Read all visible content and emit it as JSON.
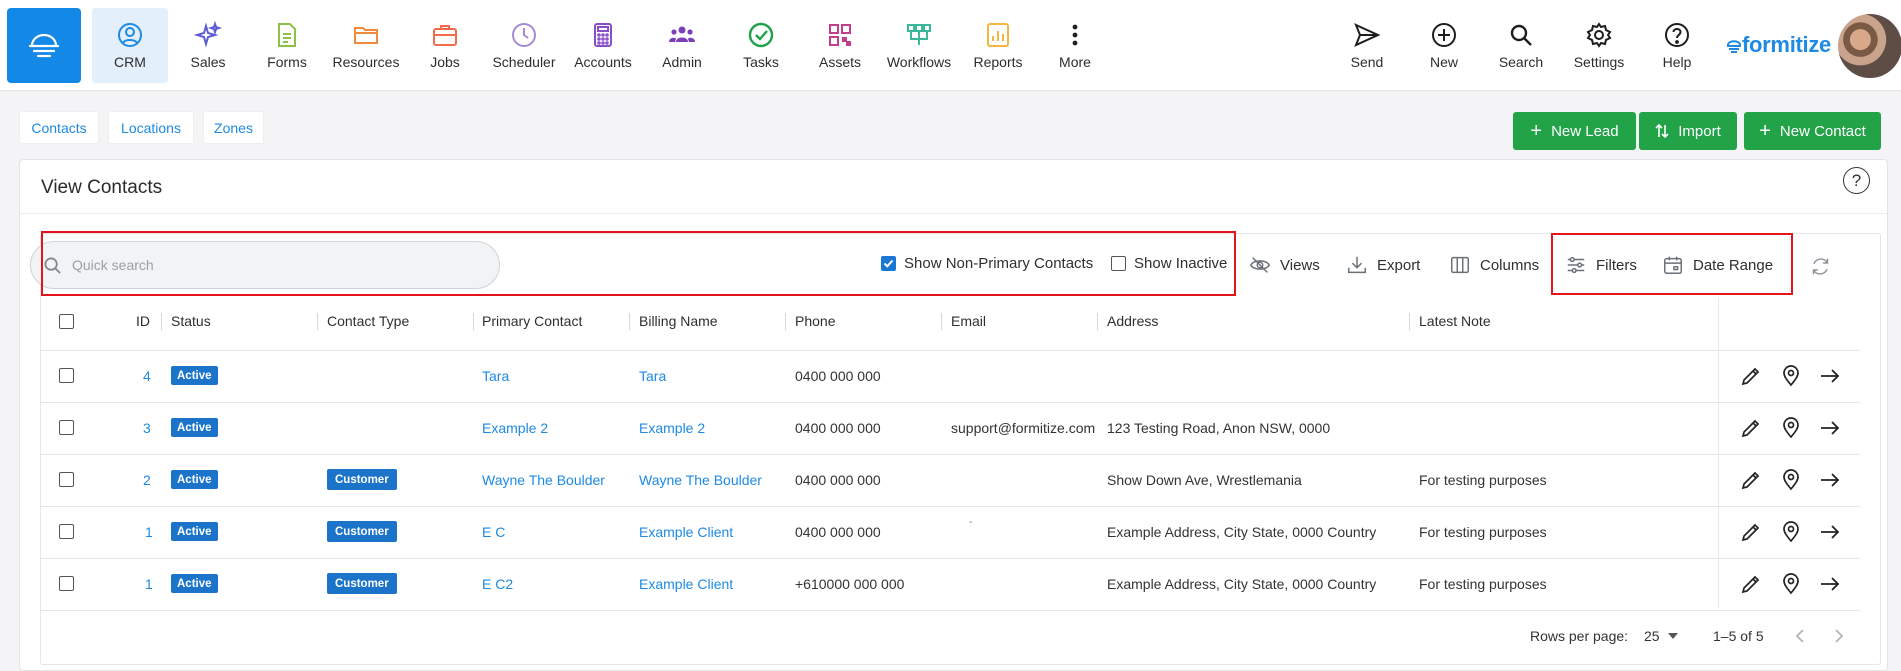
{
  "nav": {
    "items": [
      {
        "label": "CRM",
        "icon": "crm-person-icon",
        "color": "#1e8ae4"
      },
      {
        "label": "Sales",
        "icon": "sparkle-icon",
        "color": "#5b5bd6"
      },
      {
        "label": "Forms",
        "icon": "form-doc-icon",
        "color": "#8bc34a"
      },
      {
        "label": "Resources",
        "icon": "folder-icon",
        "color": "#f08a3c"
      },
      {
        "label": "Jobs",
        "icon": "briefcase-icon",
        "color": "#f26b4a"
      },
      {
        "label": "Scheduler",
        "icon": "clock-icon",
        "color": "#a48bd6"
      },
      {
        "label": "Accounts",
        "icon": "calculator-icon",
        "color": "#8a4fc7"
      },
      {
        "label": "Admin",
        "icon": "people-icon",
        "color": "#7a3fb8"
      },
      {
        "label": "Tasks",
        "icon": "check-circle-icon",
        "color": "#1fa34a"
      },
      {
        "label": "Assets",
        "icon": "qr-icon",
        "color": "#c23e8a"
      },
      {
        "label": "Workflows",
        "icon": "workflow-icon",
        "color": "#3bb89a"
      },
      {
        "label": "Reports",
        "icon": "chart-icon",
        "color": "#f4b640"
      },
      {
        "label": "More",
        "icon": "more-dots-icon",
        "color": "#222222"
      }
    ],
    "right": [
      {
        "label": "Send",
        "icon": "send-icon"
      },
      {
        "label": "New",
        "icon": "plus-circle-icon"
      },
      {
        "label": "Search",
        "icon": "search-icon"
      },
      {
        "label": "Settings",
        "icon": "gear-icon"
      },
      {
        "label": "Help",
        "icon": "help-icon"
      }
    ],
    "logo": "formitize"
  },
  "subtabs": [
    "Contacts",
    "Locations",
    "Zones"
  ],
  "actions": {
    "new_lead": "New Lead",
    "import": "Import",
    "new_contact": "New Contact"
  },
  "card": {
    "title": "View Contacts",
    "help": "?"
  },
  "toolbar": {
    "search_placeholder": "Quick search",
    "show_non_primary": "Show Non-Primary Contacts",
    "show_non_primary_checked": true,
    "show_inactive": "Show Inactive",
    "show_inactive_checked": false,
    "views": "Views",
    "export": "Export",
    "columns": "Columns",
    "filters": "Filters",
    "date_range": "Date Range"
  },
  "table": {
    "headers": [
      "ID",
      "Status",
      "Contact Type",
      "Primary Contact",
      "Billing Name",
      "Phone",
      "Email",
      "Address",
      "Latest Note"
    ],
    "rows": [
      {
        "id": "4",
        "status": "Active",
        "type": "",
        "primary": "Tara",
        "billing": "Tara",
        "phone": "0400 000 000",
        "email": "",
        "address": "",
        "note": ""
      },
      {
        "id": "3",
        "status": "Active",
        "type": "",
        "primary": "Example 2",
        "billing": "Example 2",
        "phone": "0400 000 000",
        "email": "support@formitize.com",
        "address": "123 Testing Road, Anon NSW, 0000",
        "note": ""
      },
      {
        "id": "2",
        "status": "Active",
        "type": "Customer",
        "primary": "Wayne The Boulder",
        "billing": "Wayne The Boulder",
        "phone": "0400 000 000",
        "email": "",
        "address": "Show Down Ave, Wrestlemania",
        "note": "For testing purposes"
      },
      {
        "id": "1",
        "status": "Active",
        "type": "Customer",
        "primary": "E C",
        "billing": "Example Client",
        "phone": "0400 000 000",
        "email": "-",
        "address": "Example Address, City State, 0000 Country",
        "note": "For testing purposes"
      },
      {
        "id": "1",
        "status": "Active",
        "type": "Customer",
        "primary": "E C2",
        "billing": "Example Client",
        "phone": "+610000 000 000",
        "email": "",
        "address": "Example Address, City State, 0000 Country",
        "note": "For testing purposes"
      }
    ]
  },
  "footer": {
    "rows_per_page_label": "Rows per page:",
    "rows_per_page_value": "25",
    "range": "1–5 of 5"
  }
}
